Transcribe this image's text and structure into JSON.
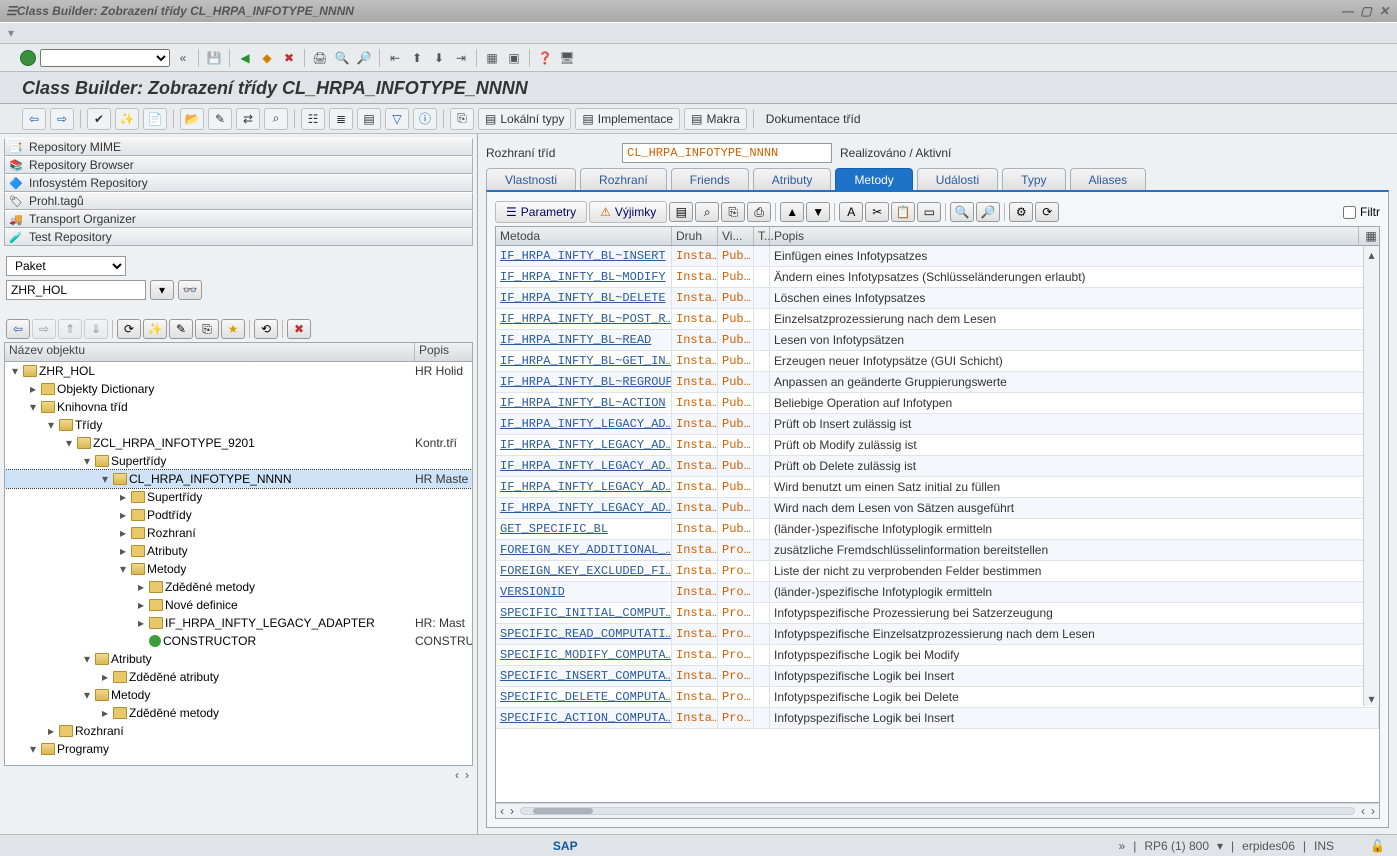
{
  "title": "Class Builder: Zobrazení třídy CL_HRPA_INFOTYPE_NNNN",
  "subtitle": "Class Builder: Zobrazení třídy CL_HRPA_INFOTYPE_NNNN",
  "apptoolbar": {
    "local_types": "Lokální typy",
    "implement": "Implementace",
    "macros": "Makra",
    "docs": "Dokumentace tříd"
  },
  "nav": {
    "0": "Repository MIME",
    "1": "Repository Browser",
    "2": "Infosystém Repository",
    "3": "Prohl.tagů",
    "4": "Transport Organizer",
    "5": "Test Repository"
  },
  "package": {
    "label": "Paket",
    "value": "ZHR_HOL"
  },
  "treehdr": {
    "name": "Název objektu",
    "desc": "Popis"
  },
  "tree": {
    "zhr_hol": "ZHR_HOL",
    "zhr_hol_desc": "HR Holid",
    "dict": "Objekty Dictionary",
    "classlib": "Knihovna tříd",
    "classes": "Třídy",
    "zcl": "ZCL_HRPA_INFOTYPE_9201",
    "zcl_desc": "Kontr.tří",
    "super": "Supertřídy",
    "sel": "CL_HRPA_INFOTYPE_NNNN",
    "sel_desc": "HR Maste",
    "sub_super": "Supertřídy",
    "sub_sub": "Podtřídy",
    "sub_if": "Rozhraní",
    "sub_attr": "Atributy",
    "sub_meth": "Metody",
    "inh_meth": "Zděděné metody",
    "new_def": "Nové definice",
    "if_legacy": "IF_HRPA_INFTY_LEGACY_ADAPTER",
    "if_legacy_desc": "HR: Mast",
    "constructor": "CONSTRUCTOR",
    "constructor_desc": "CONSTRU",
    "attr2": "Atributy",
    "inh_attr": "Zděděné atributy",
    "meth2": "Metody",
    "inh_meth2": "Zděděné metody",
    "if2": "Rozhraní",
    "prog": "Programy"
  },
  "classif": {
    "label": "Rozhraní tříd",
    "value": "CL_HRPA_INFOTYPE_NNNN",
    "status": "Realizováno / Aktivní"
  },
  "tabs": {
    "0": "Vlastnosti",
    "1": "Rozhraní",
    "2": "Friends",
    "3": "Atributy",
    "4": "Metody",
    "5": "Události",
    "6": "Typy",
    "7": "Aliases"
  },
  "methtb": {
    "params": "Parametry",
    "except": "Výjimky",
    "filter": "Filtr"
  },
  "cols": {
    "meth": "Metoda",
    "druh": "Druh",
    "vi": "Vi...",
    "t": "T...",
    "popis": "Popis"
  },
  "rows": [
    {
      "m": "IF_HRPA_INFTY_BL~INSERT",
      "d": "Insta…",
      "v": "Pub…",
      "p": "Einfügen eines Infotypsatzes"
    },
    {
      "m": "IF_HRPA_INFTY_BL~MODIFY",
      "d": "Insta…",
      "v": "Pub…",
      "p": "Ändern eines Infotypsatzes (Schlüsseländerungen erlaubt)"
    },
    {
      "m": "IF_HRPA_INFTY_BL~DELETE",
      "d": "Insta…",
      "v": "Pub…",
      "p": "Löschen eines Infotypsatzes"
    },
    {
      "m": "IF_HRPA_INFTY_BL~POST_R…",
      "d": "Insta…",
      "v": "Pub…",
      "p": "Einzelsatzprozessierung nach dem Lesen"
    },
    {
      "m": "IF_HRPA_INFTY_BL~READ",
      "d": "Insta…",
      "v": "Pub…",
      "p": "Lesen von Infotypsätzen"
    },
    {
      "m": "IF_HRPA_INFTY_BL~GET_IN…",
      "d": "Insta…",
      "v": "Pub…",
      "p": "Erzeugen neuer Infotypsätze (GUI Schicht)"
    },
    {
      "m": "IF_HRPA_INFTY_BL~REGROUP",
      "d": "Insta…",
      "v": "Pub…",
      "p": "Anpassen an geänderte Gruppierungswerte"
    },
    {
      "m": "IF_HRPA_INFTY_BL~ACTION",
      "d": "Insta…",
      "v": "Pub…",
      "p": "Beliebige Operation auf Infotypen"
    },
    {
      "m": "IF_HRPA_INFTY_LEGACY_AD…",
      "d": "Insta…",
      "v": "Pub…",
      "p": "Prüft  ob Insert zulässig ist"
    },
    {
      "m": "IF_HRPA_INFTY_LEGACY_AD…",
      "d": "Insta…",
      "v": "Pub…",
      "p": "Prüft ob Modify zulässig ist"
    },
    {
      "m": "IF_HRPA_INFTY_LEGACY_AD…",
      "d": "Insta…",
      "v": "Pub…",
      "p": "Prüft ob Delete zulässig ist"
    },
    {
      "m": "IF_HRPA_INFTY_LEGACY_AD…",
      "d": "Insta…",
      "v": "Pub…",
      "p": "Wird benutzt um einen Satz initial zu füllen"
    },
    {
      "m": "IF_HRPA_INFTY_LEGACY_AD…",
      "d": "Insta…",
      "v": "Pub…",
      "p": "Wird nach dem Lesen von Sätzen ausgeführt"
    },
    {
      "m": "GET_SPECIFIC_BL",
      "d": "Insta…",
      "v": "Pub…",
      "p": "(länder-)spezifische Infotyplogik ermitteln"
    },
    {
      "m": "FOREIGN_KEY_ADDITIONAL_…",
      "d": "Insta…",
      "v": "Pro…",
      "p": "zusätzliche Fremdschlüsselinformation bereitstellen"
    },
    {
      "m": "FOREIGN_KEY_EXCLUDED_FI…",
      "d": "Insta…",
      "v": "Pro…",
      "p": "Liste der nicht zu verprobenden Felder bestimmen"
    },
    {
      "m": "VERSIONID",
      "d": "Insta…",
      "v": "Pro…",
      "p": "(länder-)spezifische Infotyplogik ermitteln"
    },
    {
      "m": "SPECIFIC_INITIAL_COMPUT…",
      "d": "Insta…",
      "v": "Pro…",
      "p": "Infotypspezifische Prozessierung bei Satzerzeugung"
    },
    {
      "m": "SPECIFIC_READ_COMPUTATI…",
      "d": "Insta…",
      "v": "Pro…",
      "p": "Infotypspezifische Einzelsatzprozessierung nach dem Lesen"
    },
    {
      "m": "SPECIFIC_MODIFY_COMPUTA…",
      "d": "Insta…",
      "v": "Pro…",
      "p": "Infotypspezifische Logik bei Modify"
    },
    {
      "m": "SPECIFIC_INSERT_COMPUTA…",
      "d": "Insta…",
      "v": "Pro…",
      "p": "Infotypspezifische Logik bei Insert"
    },
    {
      "m": "SPECIFIC_DELETE_COMPUTA…",
      "d": "Insta…",
      "v": "Pro…",
      "p": "Infotypspezifische Logik bei Delete"
    },
    {
      "m": "SPECIFIC_ACTION_COMPUTA…",
      "d": "Insta…",
      "v": "Pro…",
      "p": "Infotypspezifische Logik bei Insert"
    }
  ],
  "status": {
    "logo": "SAP",
    "sys": "RP6 (1) 800",
    "server": "erpides06",
    "mode": "INS"
  }
}
